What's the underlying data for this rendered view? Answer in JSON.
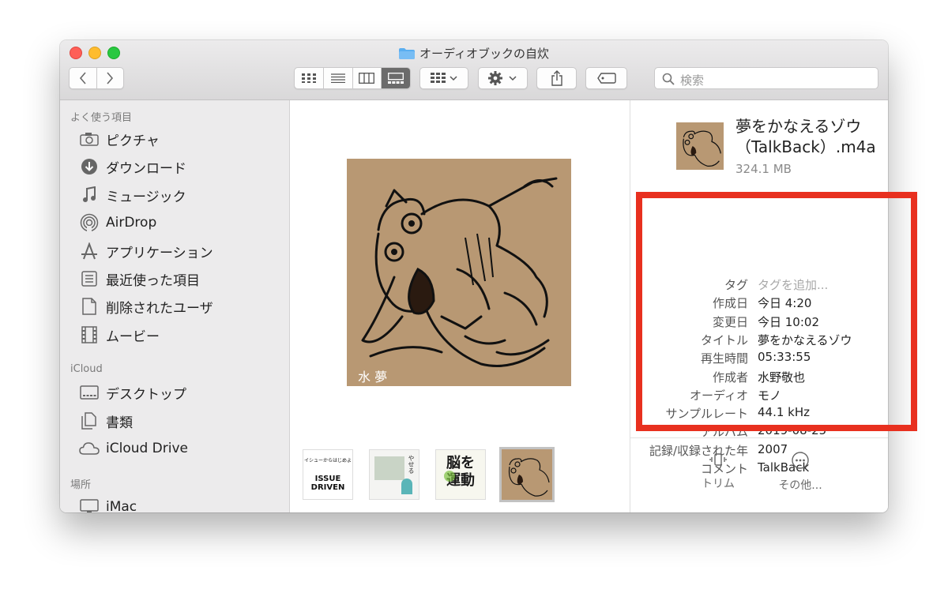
{
  "window": {
    "title": "オーディオブックの自炊"
  },
  "toolbar": {
    "back_icon": "chevron-left-icon",
    "forward_icon": "chevron-right-icon",
    "view_modes": [
      "icon-view",
      "list-view",
      "column-view",
      "gallery-view"
    ],
    "active_view": "gallery-view",
    "group_icon": "group-by-icon",
    "action_icon": "gear-icon",
    "share_icon": "share-icon",
    "tag_icon": "tag-icon"
  },
  "search": {
    "placeholder": "検索"
  },
  "sidebar": {
    "favorites_header": "よく使う項目",
    "favorites": [
      {
        "label": "ピクチャ",
        "icon": "camera-icon"
      },
      {
        "label": "ダウンロード",
        "icon": "download-icon"
      },
      {
        "label": "ミュージック",
        "icon": "music-note-icon"
      },
      {
        "label": "AirDrop",
        "icon": "airdrop-icon"
      },
      {
        "label": "アプリケーション",
        "icon": "applications-icon"
      },
      {
        "label": "最近使った項目",
        "icon": "recents-icon"
      },
      {
        "label": "削除されたユーザ",
        "icon": "document-icon"
      },
      {
        "label": "ムービー",
        "icon": "film-icon"
      }
    ],
    "icloud_header": "iCloud",
    "icloud": [
      {
        "label": "デスクトップ",
        "icon": "desktop-icon"
      },
      {
        "label": "書類",
        "icon": "documents-icon"
      },
      {
        "label": "iCloud Drive",
        "icon": "cloud-icon"
      }
    ],
    "locations_header": "場所",
    "locations": [
      {
        "label": "iMac",
        "icon": "imac-icon"
      }
    ]
  },
  "preview": {
    "cover_text": "夢\n水",
    "thumbnails": [
      {
        "name": "thumbnail-issue-driven",
        "top_text": "イシューからはじめよ",
        "big_text": "ISSUE DRIVEN"
      },
      {
        "name": "thumbnail-yaseru",
        "top_text": "やせる"
      },
      {
        "name": "thumbnail-noh-undo",
        "big_text": "脳を 運動"
      },
      {
        "name": "thumbnail-yume-wo-kanaeru-zou",
        "selected": true
      }
    ]
  },
  "inspector": {
    "file_name_line1": "夢をかなえるゾウ",
    "file_name_line2": "（TalkBack）.m4a",
    "file_size": "324.1 MB",
    "metadata": [
      {
        "key": "タグ",
        "value": "タグを追加...",
        "placeholder": true
      },
      {
        "key": "作成日",
        "value": "今日 4:20"
      },
      {
        "key": "変更日",
        "value": "今日 10:02"
      },
      {
        "key": "タイトル",
        "value": "夢をかなえるゾウ"
      },
      {
        "key": "再生時間",
        "value": "05:33:55"
      },
      {
        "key": "作成者",
        "value": "水野敬也"
      },
      {
        "key": "オーディオ",
        "value": "モノ"
      },
      {
        "key": "サンプルレート",
        "value": "44.1 kHz"
      },
      {
        "key": "アルバム",
        "value": "2019-08-25"
      },
      {
        "key": "記録/収録された年",
        "value": "2007"
      },
      {
        "key": "コメント",
        "value": "TalkBack"
      }
    ],
    "actions": [
      {
        "label": "トリム",
        "icon": "trim-icon"
      },
      {
        "label": "その他...",
        "icon": "more-icon"
      }
    ]
  },
  "annotation": {
    "highlight_color": "#e8301f"
  }
}
